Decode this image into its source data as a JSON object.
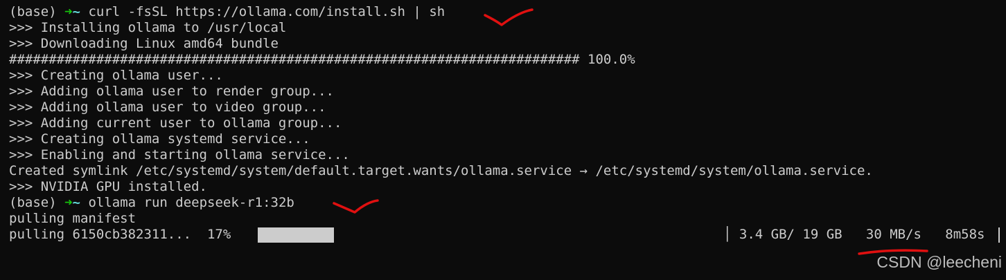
{
  "colors": {
    "background": "#0c0c0c",
    "foreground": "#cccccc",
    "prompt_arrow": "#16c60c",
    "prompt_tilde": "#61d6d6",
    "annotation": "#e01010"
  },
  "prompt": {
    "env": "(base) ",
    "arrow": "➜",
    "tilde": "~"
  },
  "commands": [
    "curl -fsSL https://ollama.com/install.sh | sh",
    "ollama run deepseek-r1:32b"
  ],
  "output_lines": [
    ">>> Installing ollama to /usr/local",
    ">>> Downloading Linux amd64 bundle",
    "######################################################################## 100.0%",
    ">>> Creating ollama user...",
    ">>> Adding ollama user to render group...",
    ">>> Adding ollama user to video group...",
    ">>> Adding current user to ollama group...",
    ">>> Creating ollama systemd service...",
    ">>> Enabling and starting ollama service...",
    "Created symlink /etc/systemd/system/default.target.wants/ollama.service → /etc/systemd/system/ollama.service.",
    ">>> NVIDIA GPU installed."
  ],
  "pull": {
    "manifest_line": "pulling manifest",
    "layer_line": "pulling 6150cb382311...  17%",
    "progress_fraction": 0.17,
    "status_line": "│ 3.4 GB/ 19 GB   30 MB/s   8m58s"
  },
  "watermark": "CSDN @leecheni"
}
